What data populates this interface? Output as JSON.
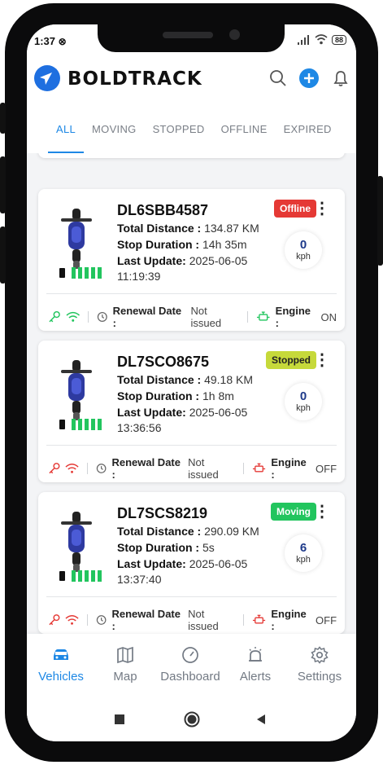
{
  "status_bar": {
    "time": "1:37",
    "battery": "88"
  },
  "header": {
    "brand": "BOLDTRACK"
  },
  "tabs": [
    {
      "label": "ALL",
      "active": true
    },
    {
      "label": "MOVING",
      "active": false
    },
    {
      "label": "STOPPED",
      "active": false
    },
    {
      "label": "OFFLINE",
      "active": false
    },
    {
      "label": "EXPIRED",
      "active": false
    }
  ],
  "vehicles": [
    {
      "plate": "DL6SBB4587",
      "status": "Offline",
      "status_color": "#e53935",
      "total_distance_label": "Total Distance :",
      "total_distance": "134.87 KM",
      "stop_duration_label": "Stop Duration :",
      "stop_duration": "14h 35m",
      "last_update_label": "Last Update:",
      "last_update_date": "2025-06-05",
      "last_update_time": "11:19:39",
      "speed": "0",
      "speed_unit": "kph",
      "renewal_label": "Renewal Date :",
      "renewal_value": "Not issued",
      "engine_label": "Engine :",
      "engine_value": "ON",
      "indicator_color": "#22c55e"
    },
    {
      "plate": "DL7SCO8675",
      "status": "Stopped",
      "status_color": "#c6d93a",
      "total_distance_label": "Total Distance :",
      "total_distance": "49.18 KM",
      "stop_duration_label": "Stop Duration :",
      "stop_duration": "1h 8m",
      "last_update_label": "Last Update:",
      "last_update_date": "2025-06-05",
      "last_update_time": "13:36:56",
      "speed": "0",
      "speed_unit": "kph",
      "renewal_label": "Renewal Date :",
      "renewal_value": "Not issued",
      "engine_label": "Engine :",
      "engine_value": "OFF",
      "indicator_color": "#e53935"
    },
    {
      "plate": "DL7SCS8219",
      "status": "Moving",
      "status_color": "#22c55e",
      "total_distance_label": "Total Distance :",
      "total_distance": "290.09 KM",
      "stop_duration_label": "Stop Duration :",
      "stop_duration": "5s",
      "last_update_label": "Last Update:",
      "last_update_date": "2025-06-05",
      "last_update_time": "13:37:40",
      "speed": "6",
      "speed_unit": "kph",
      "renewal_label": "Renewal Date :",
      "renewal_value": "Not issued",
      "engine_label": "Engine :",
      "engine_value": "OFF",
      "indicator_color": "#e53935"
    }
  ],
  "bottom_nav": [
    {
      "label": "Vehicles",
      "icon": "car-icon",
      "active": true
    },
    {
      "label": "Map",
      "icon": "map-icon",
      "active": false
    },
    {
      "label": "Dashboard",
      "icon": "gauge-icon",
      "active": false
    },
    {
      "label": "Alerts",
      "icon": "alarm-icon",
      "active": false
    },
    {
      "label": "Settings",
      "icon": "gear-icon",
      "active": false
    }
  ],
  "colors": {
    "accent": "#1e88e5",
    "brand": "#1e6fe0"
  }
}
